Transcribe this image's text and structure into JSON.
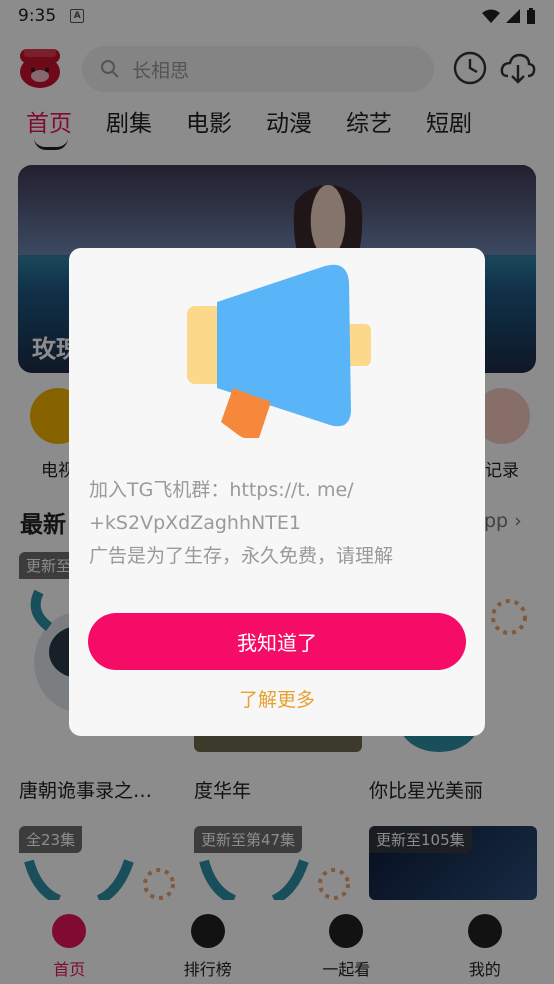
{
  "status_bar": {
    "time": "9:35",
    "a_icon": "A"
  },
  "search": {
    "placeholder": "长相思"
  },
  "tabs": [
    {
      "label": "首页"
    },
    {
      "label": "剧集"
    },
    {
      "label": "电影"
    },
    {
      "label": "动漫"
    },
    {
      "label": "综艺"
    },
    {
      "label": "短剧"
    }
  ],
  "banner": {
    "title": "玫瑰"
  },
  "quick": [
    {
      "label": "电视"
    },
    {
      "label": "记录"
    }
  ],
  "section": {
    "title": "最新",
    "more": "pp"
  },
  "cards": [
    {
      "badge": "更新至",
      "name": "唐朝诡事录之…"
    },
    {
      "badge": "",
      "name": "度华年"
    },
    {
      "badge": "",
      "name": "你比星光美丽"
    },
    {
      "badge": "全23集",
      "name": ""
    },
    {
      "badge": "更新至第47集",
      "name": ""
    },
    {
      "badge": "更新至105集",
      "name": ""
    }
  ],
  "bottom_nav": [
    {
      "label": "首页",
      "icon": "home-icon"
    },
    {
      "label": "排行榜",
      "icon": "ranking-icon"
    },
    {
      "label": "一起看",
      "icon": "watch-together-icon"
    },
    {
      "label": "我的",
      "icon": "profile-icon"
    }
  ],
  "dialog": {
    "message": "加入TG飞机群：https://t. me/ +kS2VpXdZaghhNTE1 广告是为了生存，永久免费，请理解",
    "line1": "加入TG飞机群：https://t. me/",
    "line2": "+kS2VpXdZaghhNTE1",
    "line3": "广告是为了生存，永久免费，请理解",
    "ok_label": "我知道了",
    "more_label": "了解更多"
  },
  "colors": {
    "accent": "#e8155c",
    "button": "#f50c66",
    "link": "#e8a031"
  }
}
